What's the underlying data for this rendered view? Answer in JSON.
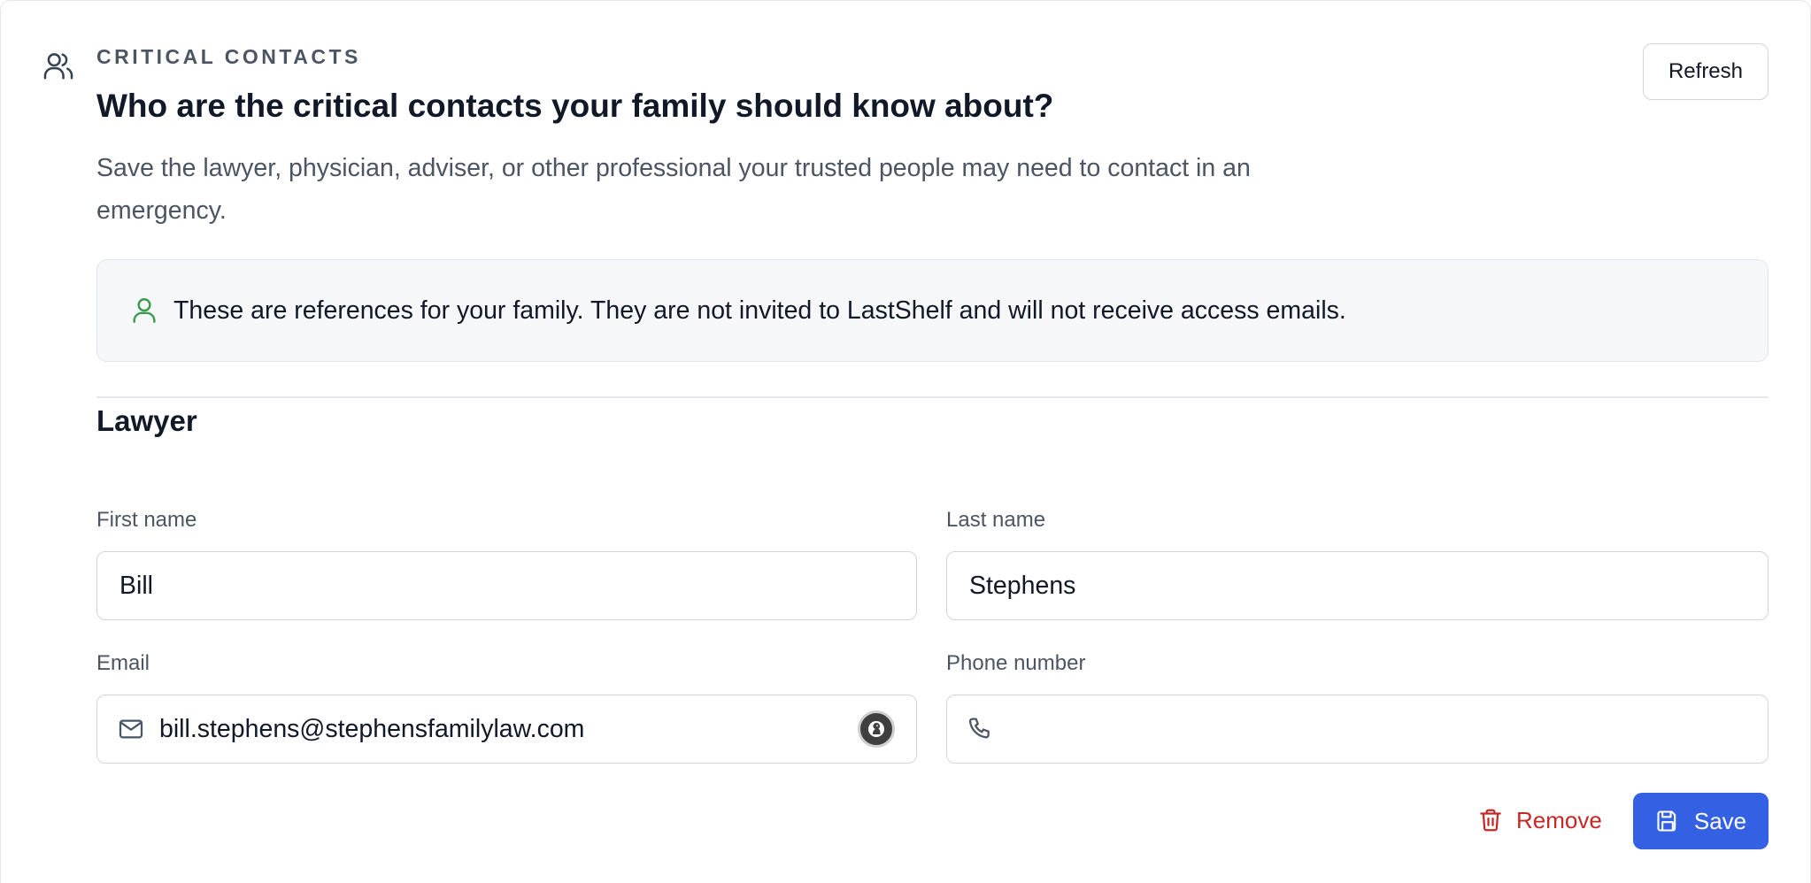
{
  "header": {
    "icon": "users-icon",
    "eyebrow": "CRITICAL CONTACTS",
    "title": "Who are the critical contacts your family should know about?",
    "subtitle": "Save the lawyer, physician, adviser, or other professional your trusted people may need to contact in an emergency.",
    "refresh_label": "Refresh"
  },
  "notice": {
    "icon": "user-icon",
    "text": "These are references for your family. They are not invited to LastShelf and will not receive access emails."
  },
  "section": {
    "title": "Lawyer",
    "fields": {
      "first_name": {
        "label": "First name",
        "value": "Bill"
      },
      "last_name": {
        "label": "Last name",
        "value": "Stephens"
      },
      "email": {
        "label": "Email",
        "value": "bill.stephens@stephensfamilylaw.com",
        "icon": "mail-icon"
      },
      "phone": {
        "label": "Phone number",
        "value": "",
        "icon": "phone-icon"
      }
    }
  },
  "actions": {
    "remove_label": "Remove",
    "save_label": "Save"
  },
  "colors": {
    "accent": "#3461e3",
    "danger": "#c62828",
    "notice_icon": "#3a9a4e"
  }
}
